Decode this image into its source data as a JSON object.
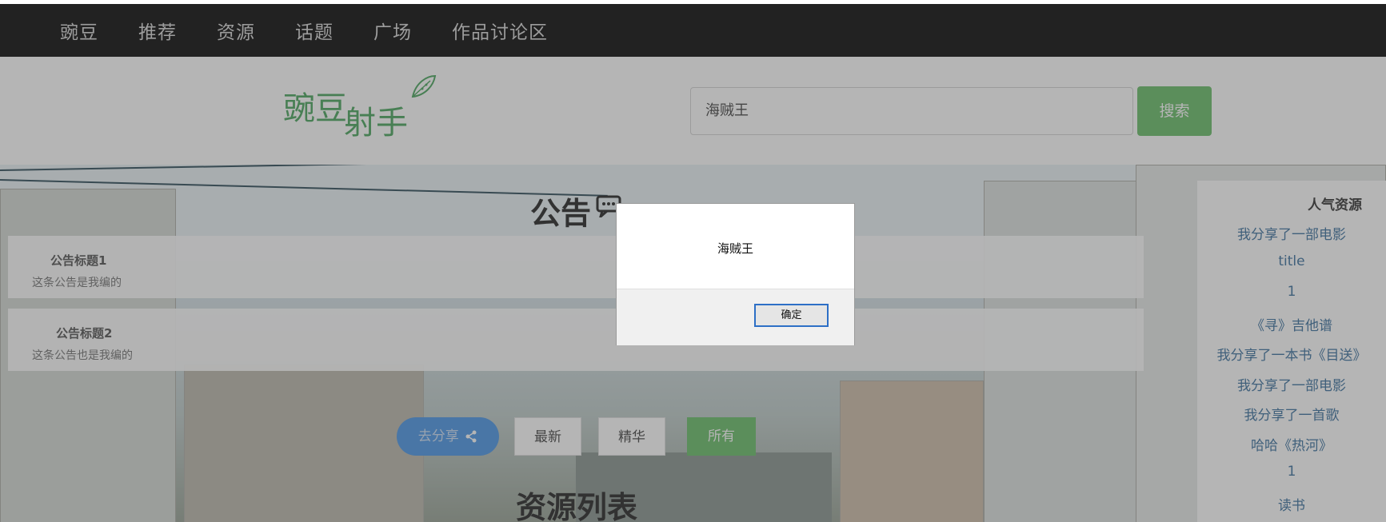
{
  "nav": {
    "items": [
      "豌豆",
      "推荐",
      "资源",
      "话题",
      "广场",
      "作品讨论区"
    ]
  },
  "header": {
    "logo_main": "豌豆",
    "logo_sub": "射手",
    "search_value": "海贼王",
    "search_button": "搜索"
  },
  "notice": {
    "title": "公告",
    "cards": [
      {
        "title": "公告标题1",
        "body": "这条公告是我编的"
      },
      {
        "title": "公告标题2",
        "body": "这条公告也是我编的"
      }
    ]
  },
  "filters": {
    "share": "去分享",
    "newest": "最新",
    "featured": "精华",
    "all": "所有"
  },
  "list_title": "资源列表",
  "sidebar": {
    "title": "人气资源",
    "items": [
      "我分享了一部电影",
      "title",
      "1",
      "《寻》吉他谱",
      "我分享了一本书《目送》",
      "我分享了一部电影",
      "我分享了一首歌",
      "哈哈《热河》",
      "1",
      "读书"
    ]
  },
  "dialog": {
    "message": "海贼王",
    "ok": "确定"
  },
  "colors": {
    "navbar": "#222222",
    "brand_green": "#5cb85c",
    "share_blue": "#3b8de3",
    "link_blue": "#2a6496"
  }
}
